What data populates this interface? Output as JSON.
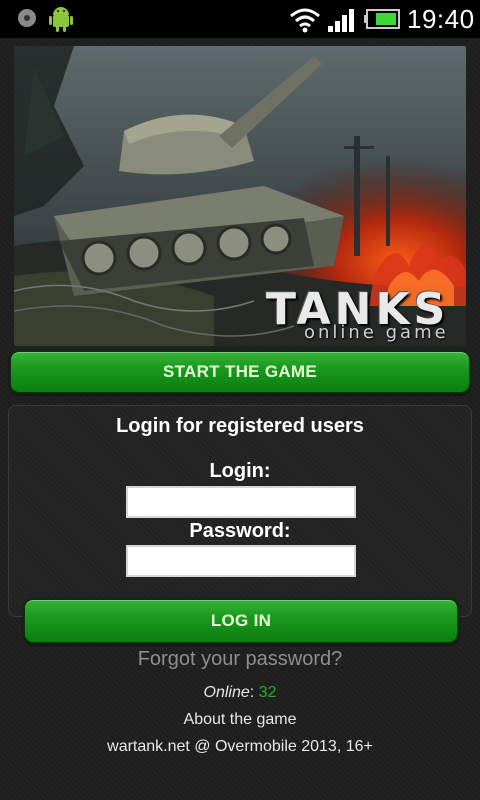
{
  "status_bar": {
    "time": "19:40",
    "icons": [
      "circle-status-icon",
      "android-robot-icon",
      "wifi-icon",
      "signal-icon",
      "battery-icon"
    ],
    "battery_color": "#3fd63a"
  },
  "hero": {
    "title": "TANKS",
    "subtitle": "online game"
  },
  "start_button": {
    "label": "START THE GAME"
  },
  "login_panel": {
    "title": "Login for registered users",
    "login_label": "Login:",
    "login_value": "",
    "password_label": "Password:",
    "password_value": ""
  },
  "login_button": {
    "label": "LOG IN"
  },
  "forgot_link": "Forgot your password?",
  "online": {
    "label": "Online",
    "separator": ":",
    "count": "32"
  },
  "about_link": "About the game",
  "footer": "wartank.net @ Overmobile 2013, 16+",
  "colors": {
    "accent_green": "#1a9a1e",
    "online_count": "#22b020",
    "background": "#1f1f1f"
  }
}
